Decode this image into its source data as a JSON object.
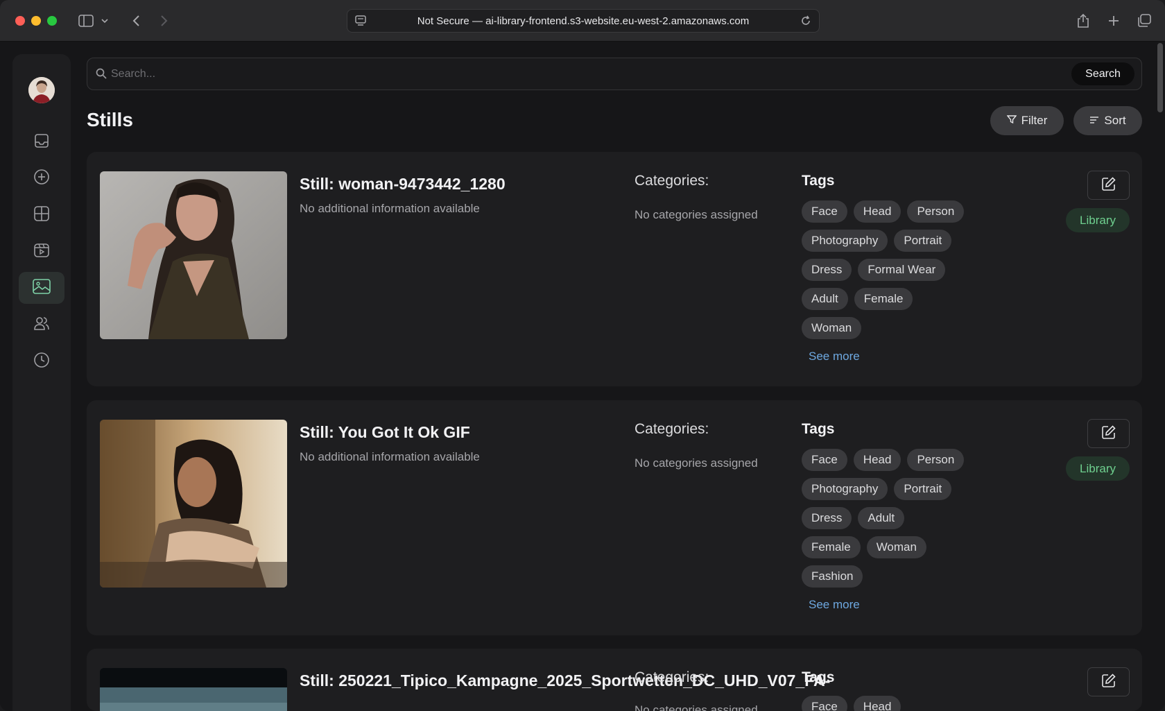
{
  "browser": {
    "url_text": "Not Secure — ai-library-frontend.s3-website.eu-west-2.amazonaws.com"
  },
  "sidebar": {
    "items": [
      {
        "name": "inbox-icon"
      },
      {
        "name": "add-circle-icon"
      },
      {
        "name": "grid-icon"
      },
      {
        "name": "video-icon"
      },
      {
        "name": "image-icon",
        "active": true
      },
      {
        "name": "users-icon"
      },
      {
        "name": "clock-icon"
      }
    ]
  },
  "search": {
    "placeholder": "Search...",
    "button_label": "Search"
  },
  "page": {
    "title": "Stills",
    "filter_label": "Filter",
    "sort_label": "Sort"
  },
  "stills": [
    {
      "title": "Still: woman-9473442_1280",
      "info": "No additional information available",
      "categories_label": "Categories:",
      "categories_value": "No categories assigned",
      "tags_label": "Tags",
      "tags": [
        "Face",
        "Head",
        "Person",
        "Photography",
        "Portrait",
        "Dress",
        "Formal Wear",
        "Adult",
        "Female",
        "Woman"
      ],
      "see_more": "See more",
      "badge": "Library"
    },
    {
      "title": "Still: You Got It Ok GIF",
      "info": "No additional information available",
      "categories_label": "Categories:",
      "categories_value": "No categories assigned",
      "tags_label": "Tags",
      "tags": [
        "Face",
        "Head",
        "Person",
        "Photography",
        "Portrait",
        "Dress",
        "Adult",
        "Female",
        "Woman",
        "Fashion"
      ],
      "see_more": "See more",
      "badge": "Library"
    },
    {
      "title": "Still: 250221_Tipico_Kampagne_2025_Sportwetten_DC_UHD_V07_FA-",
      "categories_label": "Categories:",
      "categories_value": "No categories assigned",
      "tags_label": "Tags",
      "tags": [
        "Face",
        "Head"
      ]
    }
  ],
  "colors": {
    "accent_green": "#6fd08f",
    "link_blue": "#6ea8e0"
  }
}
